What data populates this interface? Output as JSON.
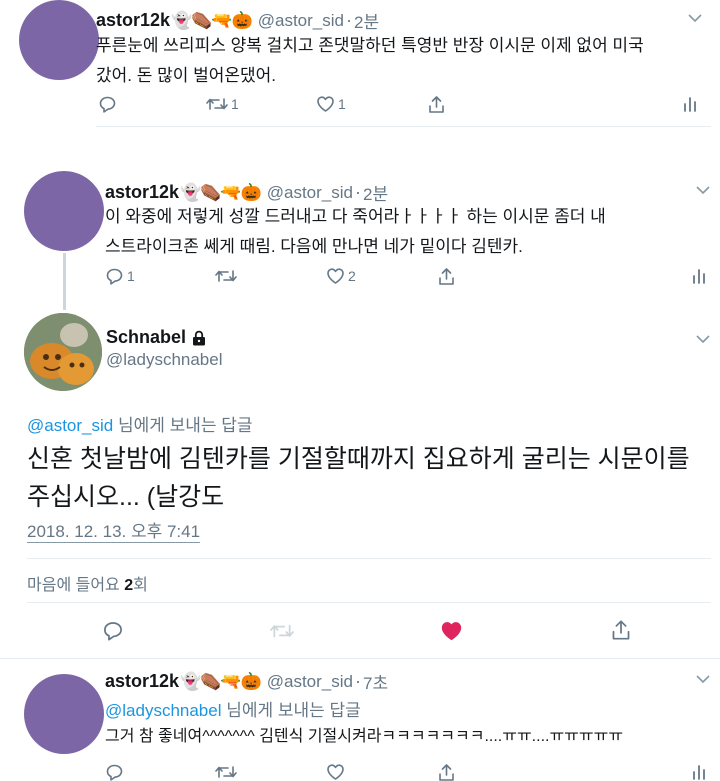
{
  "tweet1": {
    "display_name": "astor12k",
    "emoji": "👻⚰️🔫🎃",
    "handle": "@astor_sid",
    "time": "2분",
    "text_line1": "푸른눈에 쓰리피스 양복 걸치고 존댓말하던 특영반 반장 이시문 이제 없어 미국",
    "text_line2": "갔어. 돈 많이 벌어온댔어.",
    "reply_count": "",
    "retweet_count": "1",
    "like_count": "1"
  },
  "tweet2": {
    "display_name": "astor12k",
    "emoji": "👻⚰️🔫🎃",
    "handle": "@astor_sid",
    "time": "2분",
    "text_line1": "이 와중에 저렇게 성깔 드러내고 다 죽어라ㅏㅏㅏㅏ 하는 이시문 좀더 내",
    "text_line2": "스트라이크존 쎄게 때림. 다음에 만나면 네가 밑이다 김텐카.",
    "reply_count": "1",
    "retweet_count": "",
    "like_count": "2"
  },
  "main_tweet": {
    "display_name": "Schnabel",
    "lock_icon": "lock-icon",
    "handle": "@ladyschnabel",
    "reply_to_handle": "@astor_sid",
    "reply_to_suffix": "님에게 보내는 답글",
    "text_line1": "신혼 첫날밤에 김텐카를 기절할때까지 집요하게 굴리는 시문이를",
    "text_line2": "주십시오... (날강도",
    "timestamp": "2018. 12. 13. 오후 7:41",
    "likes_label_prefix": "마음에 들어요 ",
    "likes_count": "2",
    "likes_label_suffix": "회",
    "liked_color": "#e0245e"
  },
  "reply_tweet": {
    "display_name": "astor12k",
    "emoji": "👻⚰️🔫🎃",
    "handle": "@astor_sid",
    "time": "7초",
    "reply_to_handle": "@ladyschnabel",
    "reply_to_suffix": "님에게 보내는 답글",
    "text_line1": "그거 참 좋네여^^^^^^^ 김텐식 기절시켜라ㅋㅋㅋㅋㅋㅋㅋ....ㅠㅠ....ㅠㅠㅠㅠㅠ"
  },
  "colors": {
    "accent": "#1b95e0",
    "secondary_text": "#657786",
    "avatar": "#7c66a6",
    "thread_line": "#ccd6dd"
  }
}
